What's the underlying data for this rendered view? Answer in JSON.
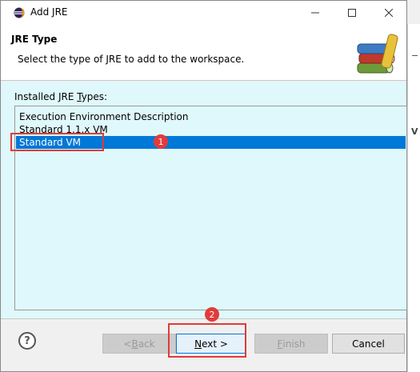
{
  "window": {
    "title": "Add JRE"
  },
  "header": {
    "title": "JRE Type",
    "description": "Select the type of JRE to add to the workspace."
  },
  "list": {
    "label_pre": "Installed JRE ",
    "label_mnemonic": "T",
    "label_post": "ypes:",
    "items": [
      {
        "label": "Execution Environment Description",
        "selected": false
      },
      {
        "label": "Standard 1.1.x VM",
        "selected": false
      },
      {
        "label": "Standard VM",
        "selected": true
      }
    ]
  },
  "buttons": {
    "back_pre": "< ",
    "back_mnemonic": "B",
    "back_post": "ack",
    "next_mnemonic": "N",
    "next_post": "ext >",
    "finish_mnemonic": "F",
    "finish_post": "inish",
    "cancel": "Cancel",
    "help": "?"
  },
  "annotations": {
    "badge_1": "1",
    "badge_2": "2"
  },
  "icons": {
    "app": "eclipse-icon",
    "minimize": "minimize-icon",
    "maximize": "maximize-icon",
    "close": "close-icon",
    "header": "books-icon",
    "help": "help-icon"
  },
  "colors": {
    "selection": "#0078d7",
    "content_bg": "#dff8fb",
    "highlight": "#e03a3a"
  }
}
